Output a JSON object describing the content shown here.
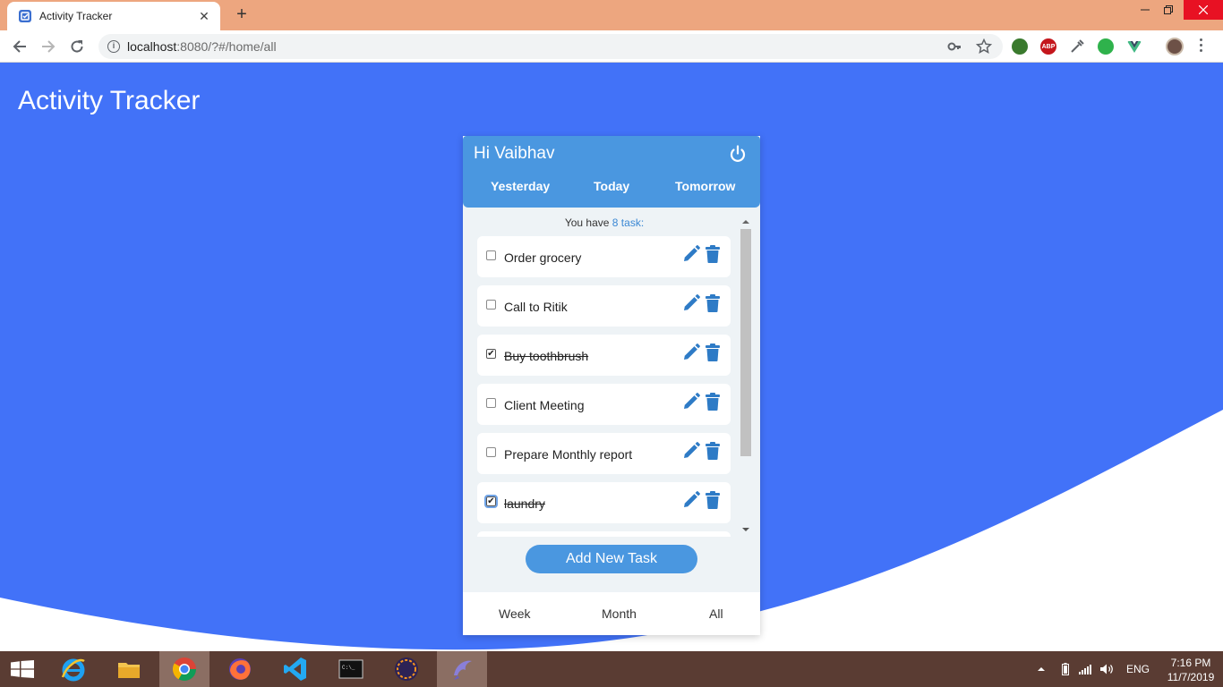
{
  "browser": {
    "tab_title": "Activity Tracker",
    "tab_close": "✕",
    "new_tab": "+",
    "url_host": "localhost",
    "url_rest": ":8080/?#/home/all",
    "ext_abp": "ABP"
  },
  "app": {
    "title": "Activity Tracker",
    "greeting": "Hi Vaibhav",
    "day_tabs": [
      "Yesterday",
      "Today",
      "Tomorrow"
    ],
    "count_prefix": "You have ",
    "count_value": "8 task:",
    "tasks": [
      {
        "text": "Order grocery",
        "done": false
      },
      {
        "text": "Call to Ritik",
        "done": false
      },
      {
        "text": "Buy toothbrush",
        "done": true
      },
      {
        "text": "Client Meeting",
        "done": false
      },
      {
        "text": "Prepare Monthly report",
        "done": false
      },
      {
        "text": "laundry",
        "done": true
      }
    ],
    "add_button": "Add New Task",
    "footer_tabs": [
      "Week",
      "Month",
      "All"
    ],
    "colors": {
      "background": "#4272f8",
      "header": "#4a97e0",
      "icon": "#2e7bc6"
    }
  },
  "taskbar": {
    "apps": [
      "internet-explorer",
      "file-explorer",
      "chrome",
      "firefox",
      "vscode",
      "command-prompt",
      "java-ee-ide",
      "app-dolphin"
    ],
    "lang": "ENG",
    "time": "7:16 PM",
    "date": "11/7/2019"
  }
}
